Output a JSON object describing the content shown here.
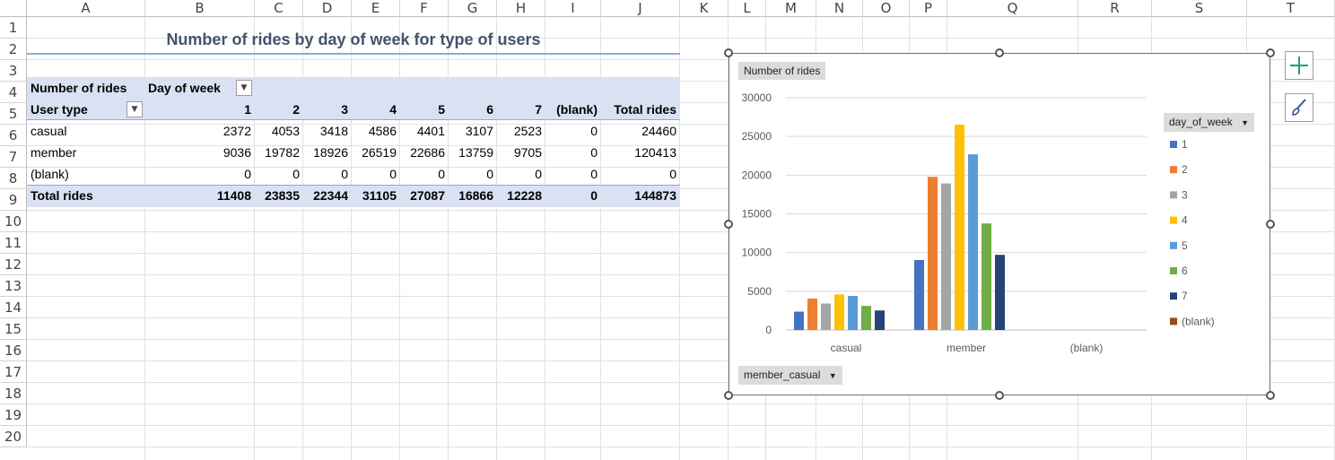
{
  "columns": [
    "A",
    "B",
    "C",
    "D",
    "E",
    "F",
    "G",
    "H",
    "I",
    "J",
    "K",
    "L",
    "M",
    "N",
    "O",
    "P",
    "Q",
    "R",
    "S",
    "T"
  ],
  "rows": [
    "1",
    "2",
    "3",
    "4",
    "5",
    "6",
    "7",
    "8",
    "9",
    "10",
    "11",
    "12",
    "13",
    "14",
    "15",
    "16",
    "17",
    "18",
    "19",
    "20"
  ],
  "pivot": {
    "title": "Number of rides by day of week for type of users",
    "values_label": "Number of rides",
    "column_field": "Day of week",
    "row_field": "User type",
    "headers": [
      "1",
      "2",
      "3",
      "4",
      "5",
      "6",
      "7",
      "(blank)",
      "Total rides"
    ],
    "rows": [
      {
        "label": "casual",
        "values": [
          "2372",
          "4053",
          "3418",
          "4586",
          "4401",
          "3107",
          "2523",
          "0",
          "24460"
        ]
      },
      {
        "label": "member",
        "values": [
          "9036",
          "19782",
          "18926",
          "26519",
          "22686",
          "13759",
          "9705",
          "0",
          "120413"
        ]
      },
      {
        "label": "(blank)",
        "values": [
          "0",
          "0",
          "0",
          "0",
          "0",
          "0",
          "0",
          "0",
          "0"
        ]
      }
    ],
    "total": {
      "label": "Total rides",
      "values": [
        "11408",
        "23835",
        "22344",
        "31105",
        "27087",
        "16866",
        "12228",
        "0",
        "144873"
      ]
    }
  },
  "chart": {
    "value_chip": "Number of rides",
    "legend_field": "day_of_week",
    "axis_field": "member_casual",
    "dropdown_glyph": "▼",
    "colors": [
      "#4472c4",
      "#ed7d31",
      "#a5a5a5",
      "#ffc000",
      "#5b9bd5",
      "#70ad47",
      "#264478",
      "#9e480e"
    ]
  },
  "chart_data": {
    "type": "bar",
    "categories": [
      "casual",
      "member",
      "(blank)"
    ],
    "series": [
      {
        "name": "1",
        "values": [
          2372,
          9036,
          0
        ]
      },
      {
        "name": "2",
        "values": [
          4053,
          19782,
          0
        ]
      },
      {
        "name": "3",
        "values": [
          3418,
          18926,
          0
        ]
      },
      {
        "name": "4",
        "values": [
          4586,
          26519,
          0
        ]
      },
      {
        "name": "5",
        "values": [
          4401,
          22686,
          0
        ]
      },
      {
        "name": "6",
        "values": [
          3107,
          13759,
          0
        ]
      },
      {
        "name": "7",
        "values": [
          2523,
          9705,
          0
        ]
      },
      {
        "name": "(blank)",
        "values": [
          0,
          0,
          0
        ]
      }
    ],
    "ylim": [
      0,
      30000
    ],
    "yticks": [
      "0",
      "5000",
      "10000",
      "15000",
      "20000",
      "25000",
      "30000"
    ],
    "grid": true,
    "legend": "right"
  }
}
